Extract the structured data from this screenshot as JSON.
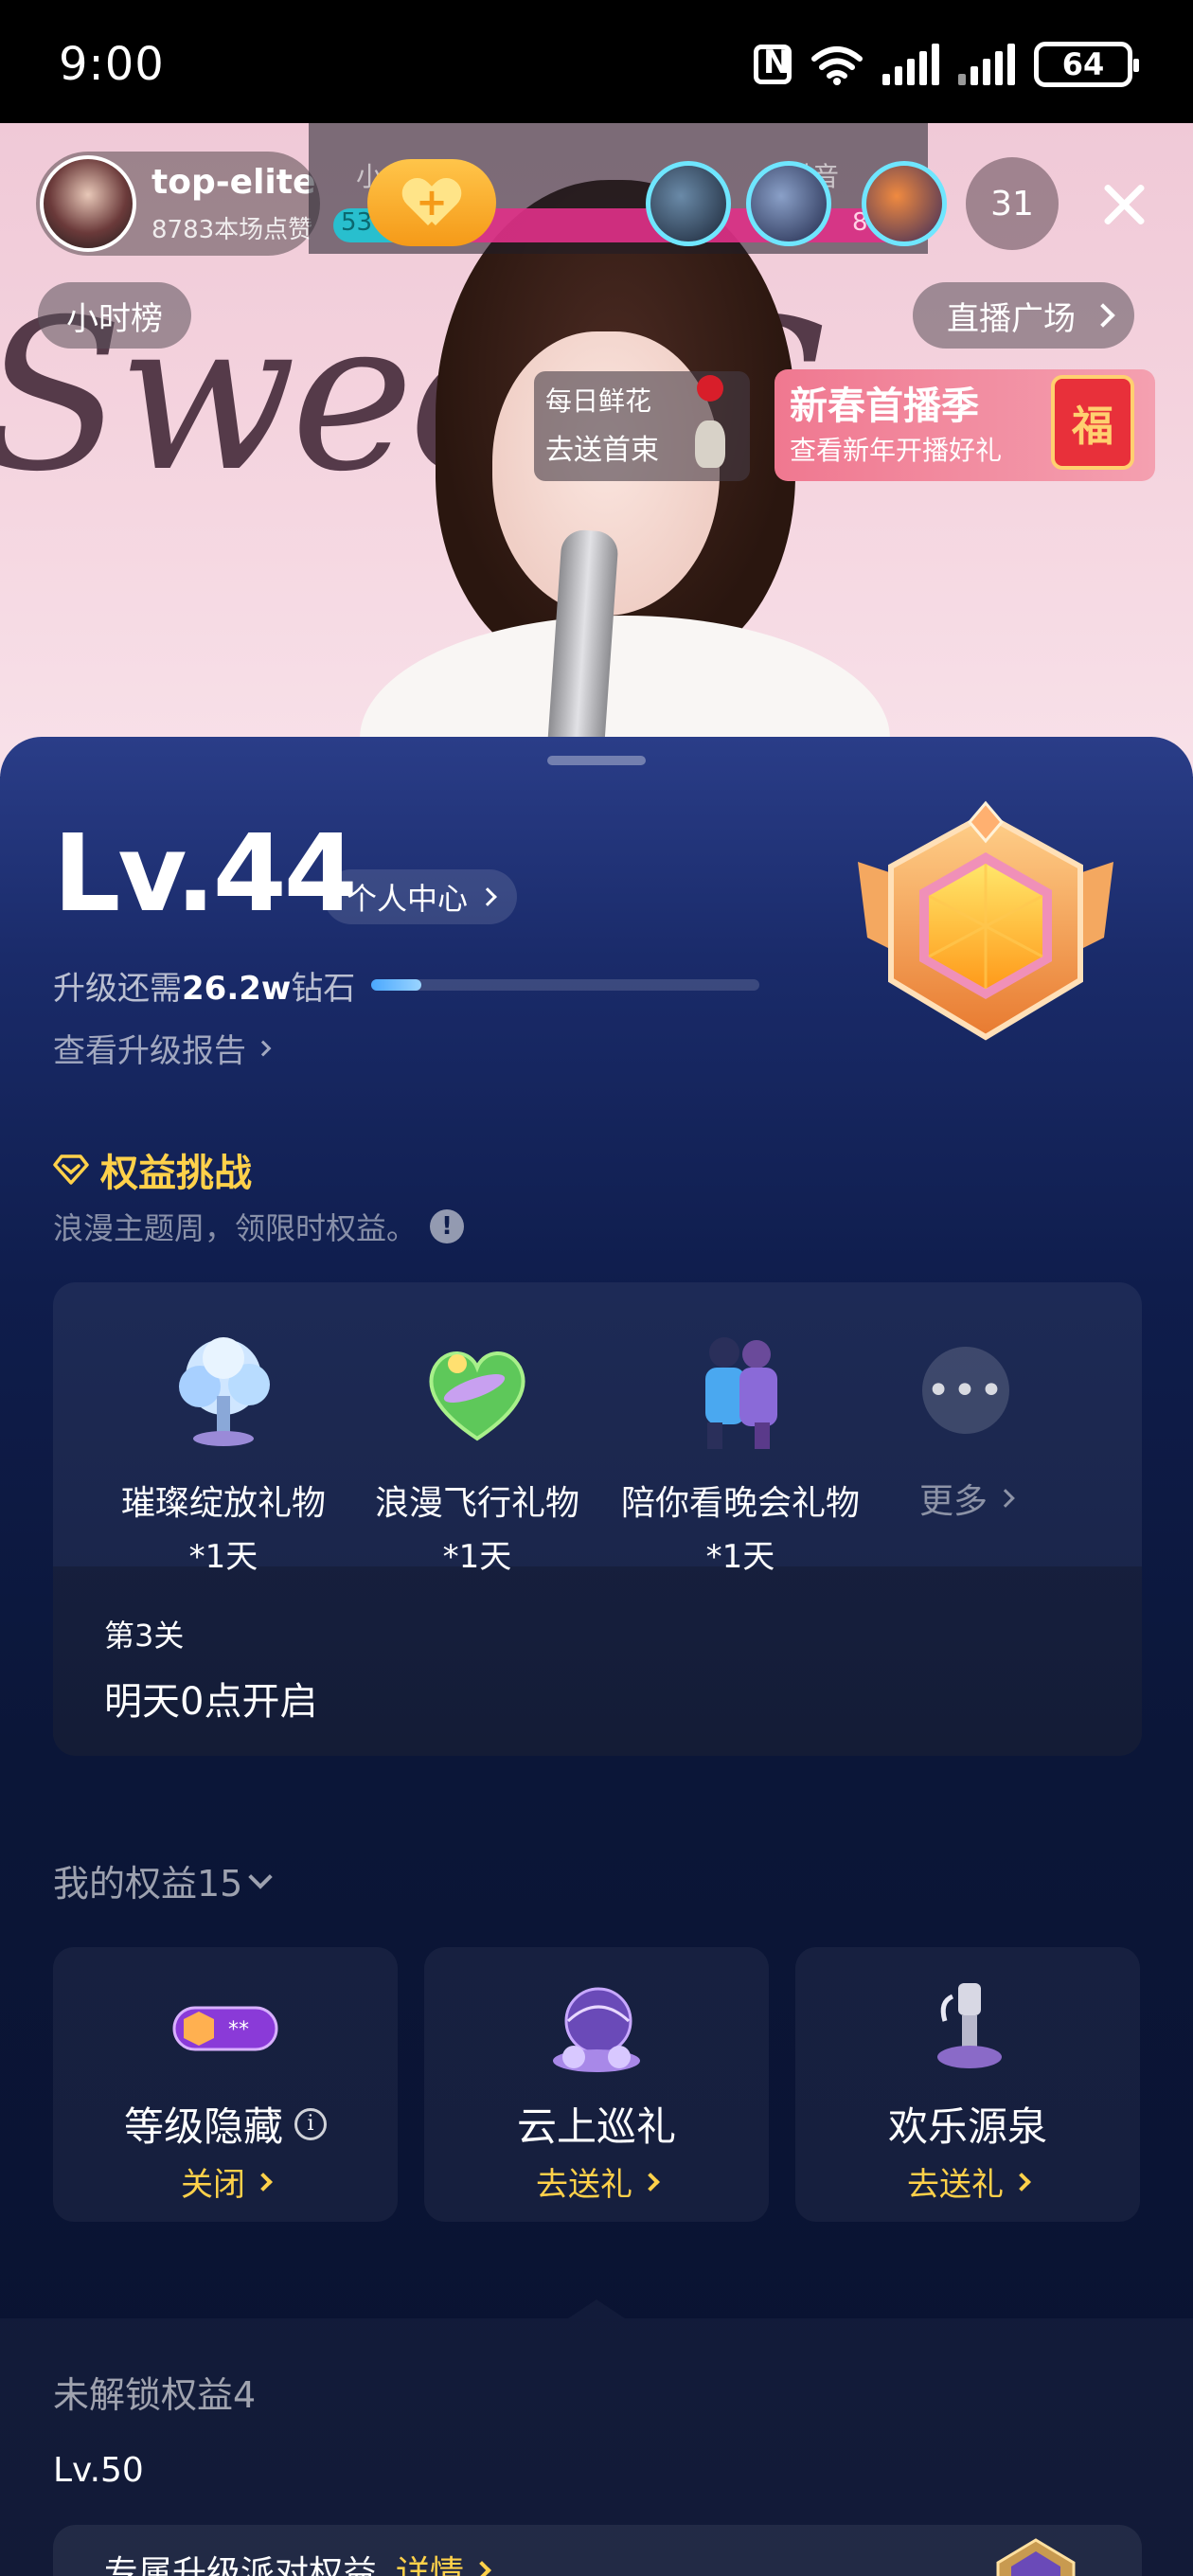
{
  "status_bar": {
    "time": "9:00",
    "battery": "64",
    "icons": [
      "nfc-icon",
      "wifi-icon",
      "signal-icon",
      "signal-icon",
      "battery-icon"
    ]
  },
  "live_room": {
    "host": {
      "name": "top-elite",
      "likes": "8783本场点赞"
    },
    "pk": {
      "left_label": "小",
      "right_label": "抖音",
      "left_score": "53",
      "right_score": "86"
    },
    "viewer_count": "31",
    "hour_rank": "小时榜",
    "live_square": "直播广场",
    "flower_card": {
      "line1": "每日鲜花",
      "line2": "去送首束"
    },
    "spring_card": {
      "title": "新春首播季",
      "subtitle": "查看新年开播好礼",
      "seal": "福"
    }
  },
  "level": {
    "label": "Lv.44",
    "personal_center": "个人中心",
    "need_prefix": "升级还需",
    "need_amount": "26.2w",
    "need_suffix": "钻石",
    "progress_fraction": 0.13,
    "report_link": "查看升级报告"
  },
  "challenge": {
    "title": "权益挑战",
    "subtitle": "浪漫主题周，领限时权益。",
    "gifts": [
      {
        "name": "璀璨绽放礼物",
        "duration": "*1天",
        "icon": "crystal-tree-icon"
      },
      {
        "name": "浪漫飞行礼物",
        "duration": "*1天",
        "icon": "heart-plane-icon"
      },
      {
        "name": "陪你看晚会礼物",
        "duration": "*1天",
        "icon": "couple-icon"
      }
    ],
    "more": "更多",
    "stage": "第3关",
    "open_time": "明天0点开启"
  },
  "my_perks": {
    "title": "我的权益15",
    "items": [
      {
        "name": "等级隐藏",
        "action": "关闭",
        "icon": "level-badge-icon"
      },
      {
        "name": "云上巡礼",
        "action": "去送礼",
        "icon": "cloud-tour-icon"
      },
      {
        "name": "欢乐源泉",
        "action": "去送礼",
        "icon": "fountain-icon"
      }
    ]
  },
  "locked": {
    "title": "未解锁权益4",
    "level": "Lv.50",
    "item_text": "专属升级派对权益",
    "detail": "详情"
  },
  "colors": {
    "accent_gold": "#ffd14a",
    "panel_top": "#2a3d88",
    "panel_bottom": "#0a1230"
  }
}
